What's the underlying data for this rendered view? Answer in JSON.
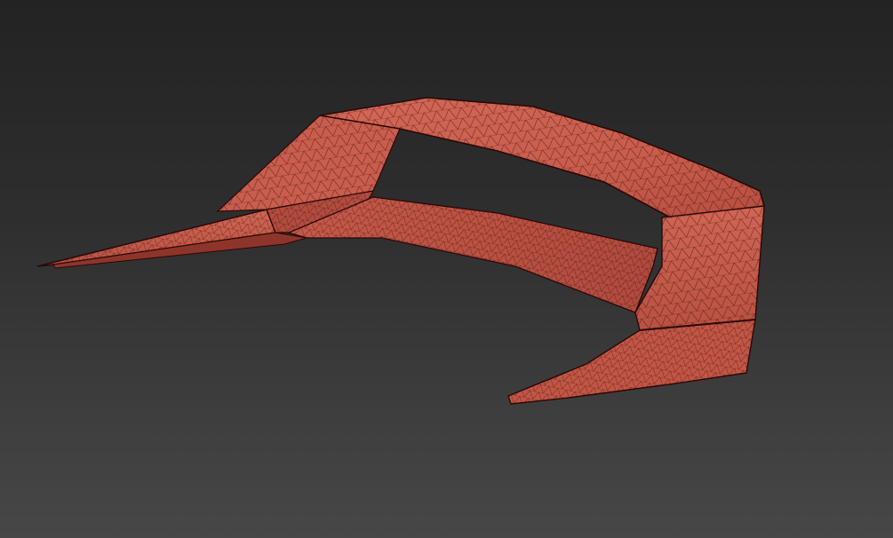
{
  "viewport": {
    "object_name": "",
    "colors": {
      "background_top": "#232323",
      "background_bottom": "#474747",
      "mesh_fill": "#c8594a",
      "mesh_fill_dark": "#a8463a",
      "mesh_fill_light": "#d76a5b",
      "mesh_wire": "#3a0f0b",
      "mesh_edge": "#2a0805"
    },
    "shading": "wireframe-over-shaded"
  }
}
